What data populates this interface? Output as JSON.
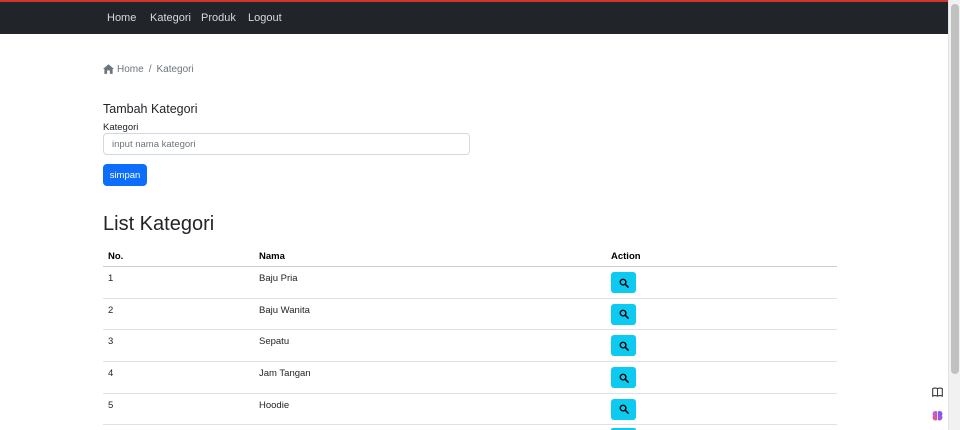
{
  "navbar": {
    "items": [
      "Home",
      "Kategori",
      "Produk",
      "Logout"
    ]
  },
  "breadcrumb": {
    "home": "Home",
    "separator": "/",
    "current": "Kategori"
  },
  "form": {
    "title": "Tambah Kategori",
    "label": "Kategori",
    "placeholder": "input nama kategori",
    "value": "",
    "submit_label": "simpan"
  },
  "list": {
    "title": "List Kategori",
    "columns": [
      "No.",
      "Nama",
      "Action"
    ],
    "rows": [
      {
        "no": "1",
        "nama": "Baju Pria"
      },
      {
        "no": "2",
        "nama": "Baju Wanita"
      },
      {
        "no": "3",
        "nama": "Sepatu"
      },
      {
        "no": "4",
        "nama": "Jam Tangan"
      },
      {
        "no": "5",
        "nama": "Hoodie"
      }
    ]
  },
  "icons": {
    "breadcrumb_home": "home-icon",
    "action": "search-icon",
    "side_top": "book-icon",
    "side_bottom": "brain-icon"
  },
  "colors": {
    "navbar": "#212529",
    "top_accent": "#d0342c",
    "primary": "#0d6efd",
    "info": "#0dcaf0"
  }
}
